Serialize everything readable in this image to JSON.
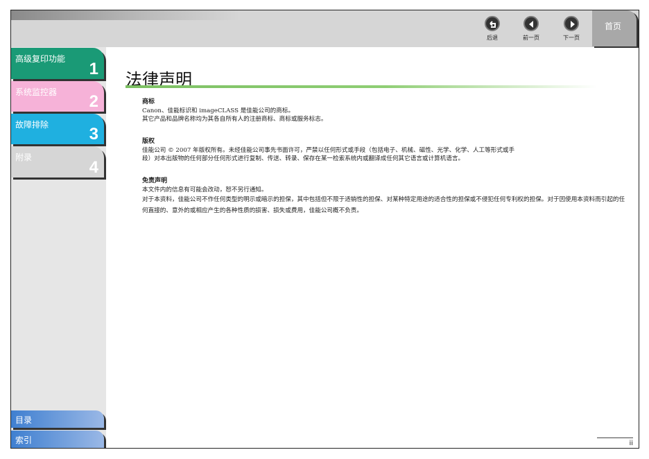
{
  "header": {
    "back": "后退",
    "prev": "前一页",
    "next": "下一页",
    "home": "首页"
  },
  "sidebar": {
    "tabs": [
      {
        "label": "高级复印功能",
        "num": "1",
        "color": "#1a9a76"
      },
      {
        "label": "系统监控器",
        "num": "2",
        "color": "#f6b2d8"
      },
      {
        "label": "故障排除",
        "num": "3",
        "color": "#1fb0e0"
      },
      {
        "label": "附录",
        "num": "4",
        "color": "#d6d6d6"
      }
    ],
    "contents": "目录",
    "index": "索引"
  },
  "main": {
    "title": "法律声明",
    "sections": [
      {
        "heading": "商标",
        "lines": [
          "Canon、佳能标识和 imageCLASS 是佳能公司的商标。",
          "其它产品和品牌名称均为其各自所有人的注册商标、商标或服务标志。"
        ]
      },
      {
        "heading": "版权",
        "lines": [
          "佳能公司 © 2007 年版权所有。未经佳能公司事先书面许可，严禁以任何形式或手段（包括电子、机械、磁性、光学、化学、人工等形式或手",
          "段）对本出版物的任何部分任何形式进行复制、传送、转录、保存在某一检索系统内或翻译成任何其它语言或计算机语言。"
        ]
      },
      {
        "heading": "免责声明",
        "lines": [
          "本文件内的信息有可能会改动，恕不另行通知。",
          "对于本资料，佳能公司不作任何类型的明示或暗示的担保，其中包括但不限于适销性的担保、对某种特定用途的适合性的担保或不侵犯任何专利权的担保。对于因使用本资料而引起的任何直接的、意外的或相应产生的各种性质的损害、损失或费用，佳能公司概不负责。"
        ]
      }
    ],
    "page_number": "ii"
  }
}
